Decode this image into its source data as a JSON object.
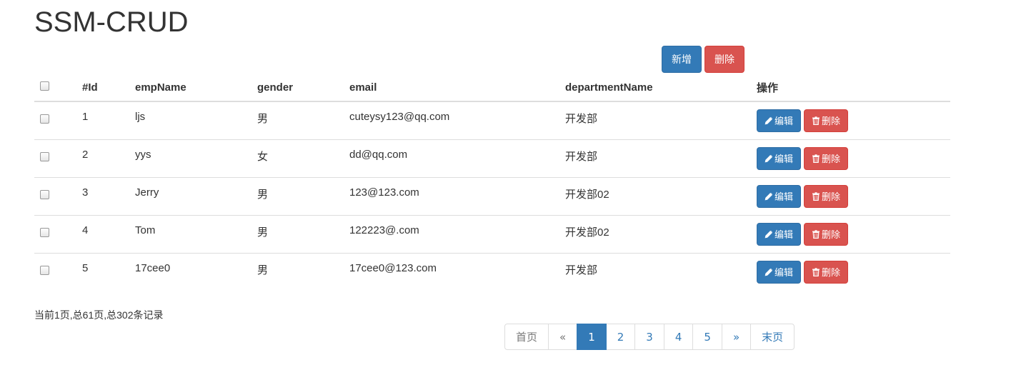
{
  "page": {
    "title": "SSM-CRUD"
  },
  "toolbar": {
    "add_label": "新增",
    "delete_label": "删除"
  },
  "table": {
    "headers": {
      "id": "#Id",
      "name": "empName",
      "gender": "gender",
      "email": "email",
      "dept": "departmentName",
      "ops": "操作"
    },
    "rows": [
      {
        "id": "1",
        "name": "ljs",
        "gender": "男",
        "email": "cuteysy123@qq.com",
        "dept": "开发部",
        "edit": "编辑",
        "delete": "删除"
      },
      {
        "id": "2",
        "name": "yys",
        "gender": "女",
        "email": "dd@qq.com",
        "dept": "开发部",
        "edit": "编辑",
        "delete": "删除"
      },
      {
        "id": "3",
        "name": "Jerry",
        "gender": "男",
        "email": "123@123.com",
        "dept": "开发部02",
        "edit": "编辑",
        "delete": "删除"
      },
      {
        "id": "4",
        "name": "Tom",
        "gender": "男",
        "email": "122223@.com",
        "dept": "开发部02",
        "edit": "编辑",
        "delete": "删除"
      },
      {
        "id": "5",
        "name": "17cee0",
        "gender": "男",
        "email": "17cee0@123.com",
        "dept": "开发部",
        "edit": "编辑",
        "delete": "删除"
      }
    ]
  },
  "page_info": "当前1页,总61页,总302条记录",
  "pagination": {
    "first": "首页",
    "prev": "«",
    "pages": [
      "1",
      "2",
      "3",
      "4",
      "5"
    ],
    "active_page": "1",
    "next": "»",
    "last": "末页"
  },
  "colors": {
    "primary": "#337ab7",
    "danger": "#d9534f",
    "border": "#dddddd"
  }
}
